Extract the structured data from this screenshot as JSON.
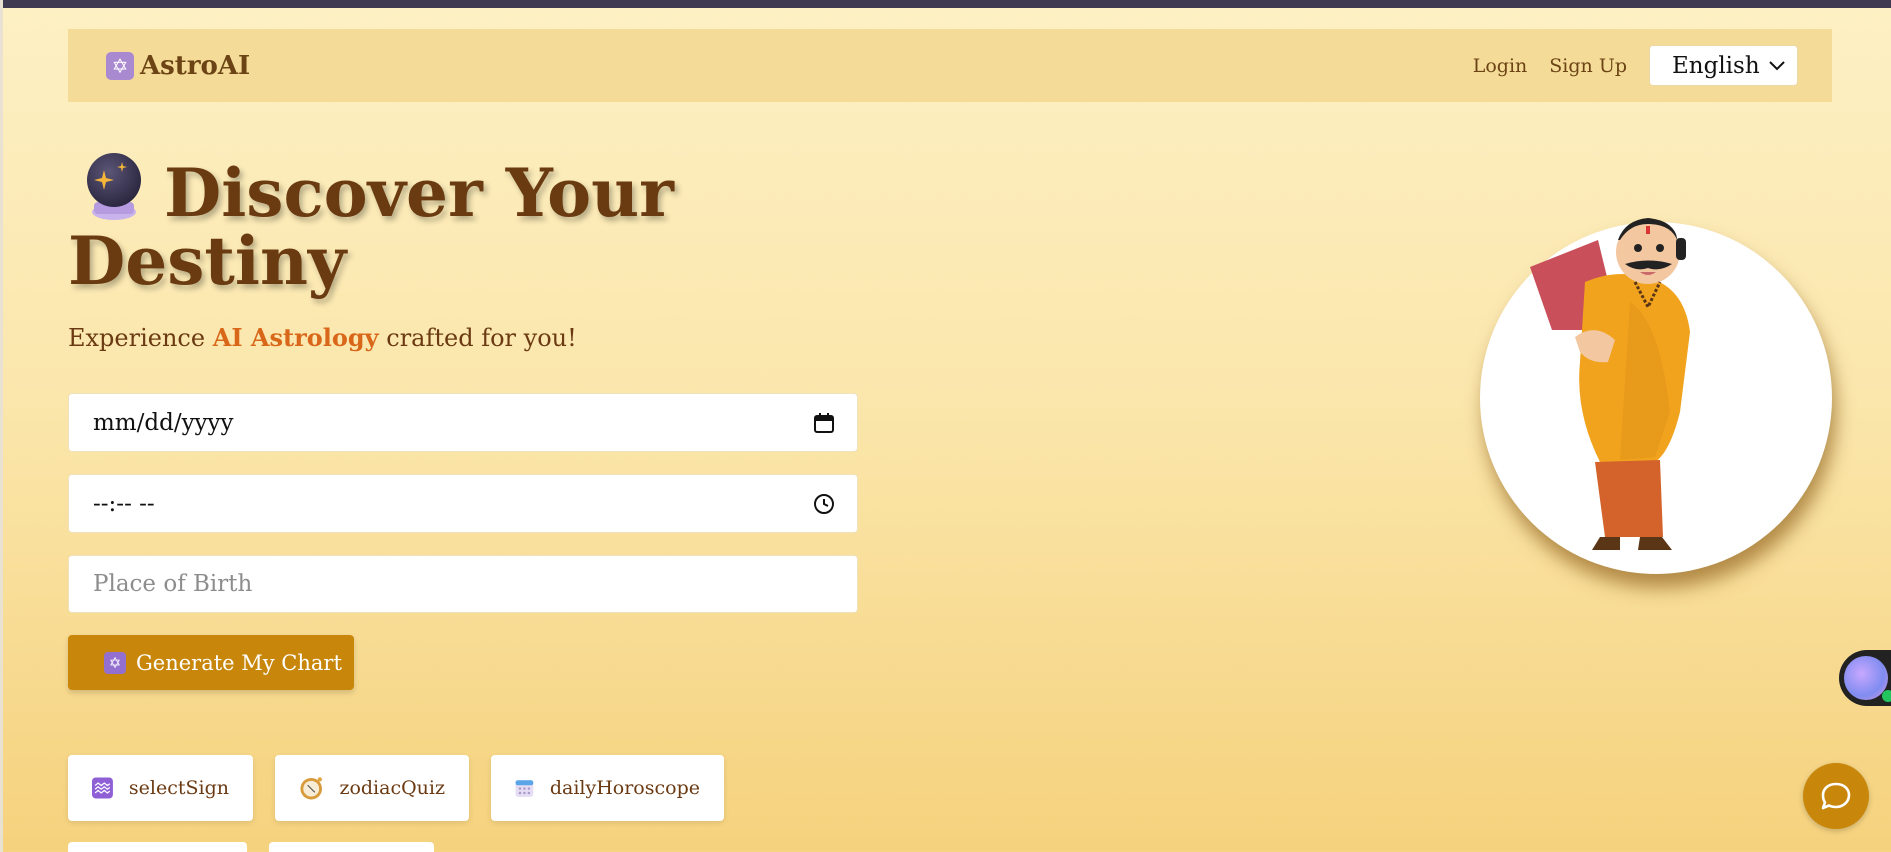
{
  "header": {
    "brand_icon": "star-of-david-icon",
    "brand_name": "AstroAI",
    "login_label": "Login",
    "signup_label": "Sign Up",
    "language_selected": "English"
  },
  "hero": {
    "title_line1": "Discover Your",
    "title_line2": "Destiny",
    "subtitle_before": "Experience ",
    "subtitle_highlight": "AI Astrology",
    "subtitle_after": " crafted for you!"
  },
  "form": {
    "date_value": "mm/dd/yyyy",
    "time_value": "--:-- --",
    "place_placeholder": "Place of Birth",
    "generate_label": "Generate My Chart"
  },
  "chips": [
    {
      "label": "selectSign",
      "icon": "aquarius-icon"
    },
    {
      "label": "zodiacQuiz",
      "icon": "compass-icon"
    },
    {
      "label": "dailyHoroscope",
      "icon": "calendar-icon"
    }
  ],
  "colors": {
    "accent": "#c8870a",
    "title": "#6a3a10",
    "highlight": "#d9671a"
  }
}
